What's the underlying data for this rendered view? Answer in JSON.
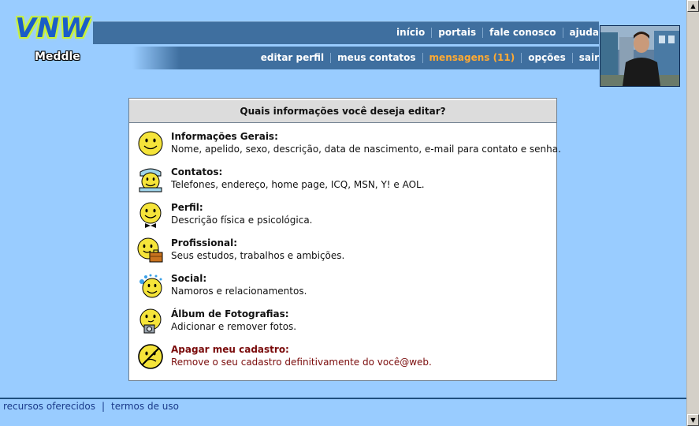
{
  "logo": {
    "text": "VNW",
    "subtitle": "Meddle"
  },
  "nav_top": [
    {
      "label": "início"
    },
    {
      "label": "portais"
    },
    {
      "label": "fale conosco"
    },
    {
      "label": "ajuda"
    }
  ],
  "nav_bottom": [
    {
      "label": "editar perfil"
    },
    {
      "label": "meus contatos"
    },
    {
      "label": "mensagens (11)"
    },
    {
      "label": "opções"
    },
    {
      "label": "sair"
    }
  ],
  "panel": {
    "title": "Quais informações você deseja editar?",
    "options": [
      {
        "icon": "smiley-icon",
        "title": "Informações Gerais:",
        "description": "Nome, apelido, sexo, descrição, data de nascimento, e-mail para contato e senha."
      },
      {
        "icon": "smiley-phone-icon",
        "title": "Contatos:",
        "description": "Telefones, endereço, home page, ICQ, MSN, Y! e AOL."
      },
      {
        "icon": "smiley-bowtie-icon",
        "title": "Perfil:",
        "description": "Descrição física e psicológica."
      },
      {
        "icon": "smiley-briefcase-icon",
        "title": "Profissional:",
        "description": "Seus estudos, trabalhos e ambições."
      },
      {
        "icon": "smiley-social-icon",
        "title": "Social:",
        "description": "Namoros e relacionamentos."
      },
      {
        "icon": "smiley-camera-icon",
        "title": "Álbum de Fotografias:",
        "description": "Adicionar e remover fotos."
      },
      {
        "icon": "crossed-smiley-icon",
        "title": "Apagar meu cadastro:",
        "description": "Remove o seu cadastro definitivamente do você@web."
      }
    ]
  },
  "footer": {
    "link1": "recursos oferecidos",
    "separator": "|",
    "link2": "termos de uso"
  },
  "colors": {
    "background": "#99ccff",
    "navbar": "#3f6f9f",
    "highlight": "#ffaa33",
    "danger": "#7a0b0b"
  }
}
